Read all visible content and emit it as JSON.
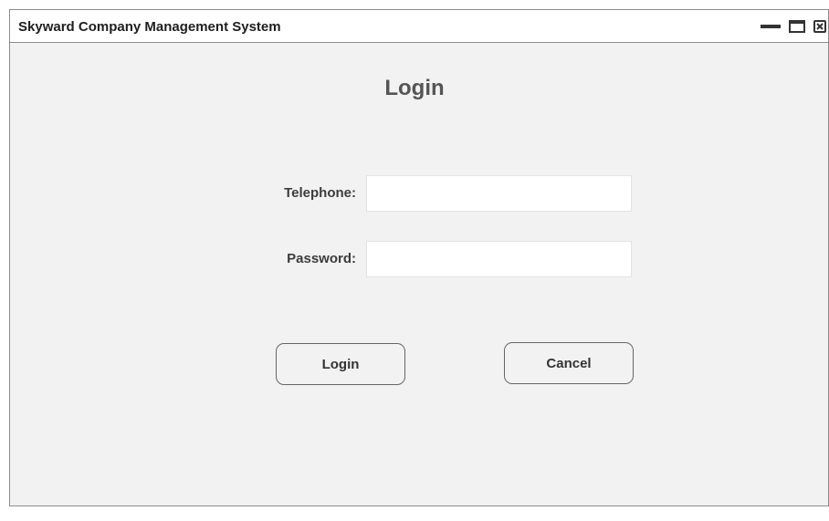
{
  "window": {
    "title": "Skyward Company Management System",
    "controls": [
      "minimize-icon",
      "maximize-icon",
      "close-icon"
    ]
  },
  "login_form": {
    "heading": "Login",
    "telephone_label": "Telephone:",
    "telephone_value": "",
    "password_label": "Password:",
    "password_value": "",
    "login_button_label": "Login",
    "cancel_button_label": "Cancel"
  },
  "colors": {
    "window_background": "#f2f2f2",
    "titlebar_background": "#ffffff",
    "border": "#8c8c8c",
    "input_background": "#ffffff",
    "heading_text": "#555555"
  }
}
